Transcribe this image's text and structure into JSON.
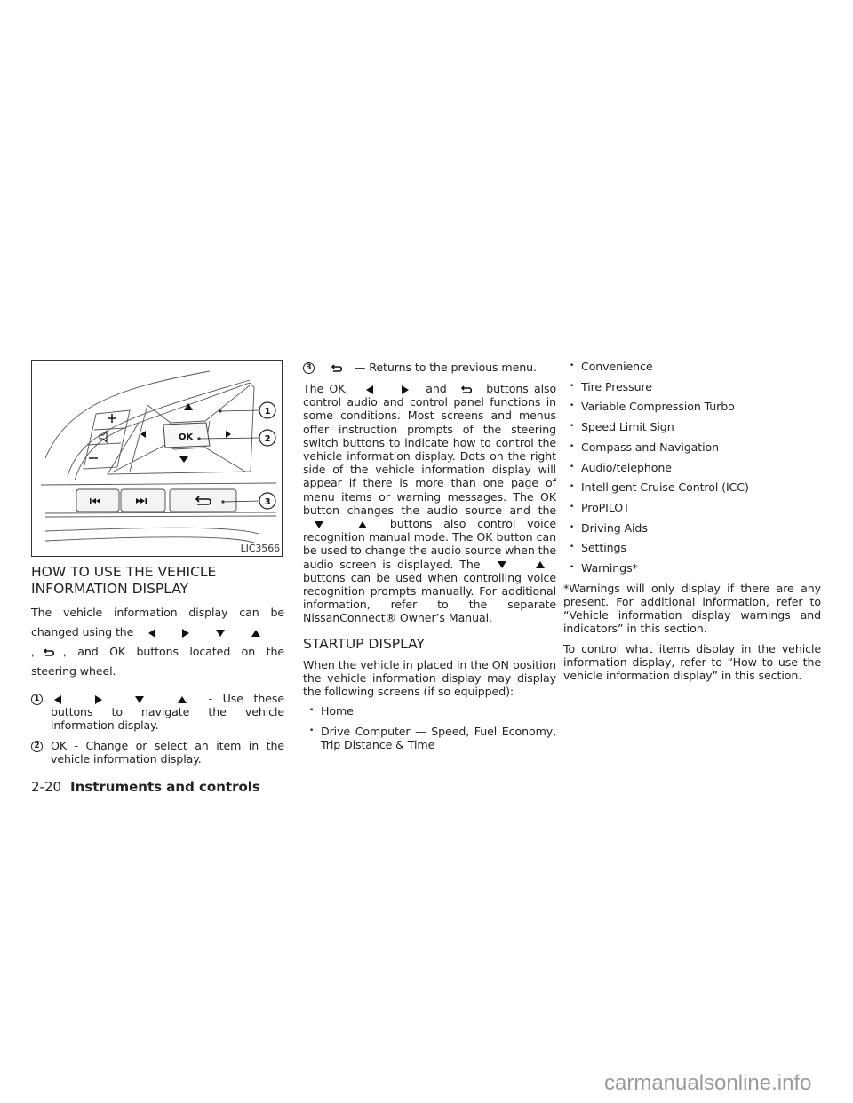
{
  "figure": {
    "label": "LIC3566",
    "callouts": [
      "1",
      "2",
      "3"
    ],
    "ok_button_label": "OK",
    "icons": [
      "volume-up-icon",
      "mute-icon",
      "volume-down-icon",
      "left-arrow-icon",
      "up-arrow-icon",
      "right-arrow-icon",
      "down-arrow-icon",
      "previous-track-icon",
      "next-track-icon",
      "back-icon"
    ]
  },
  "section1": {
    "heading_line1": "HOW TO USE THE VEHICLE",
    "heading_line2": "INFORMATION DISPLAY",
    "intro_part1": "The vehicle information display can be changed using the",
    "intro_part2": ",",
    "intro_part3": ", and OK buttons located on the steering wheel.",
    "items": [
      {
        "num": "1",
        "text": "- Use these buttons to navigate the vehicle information display."
      },
      {
        "num": "2",
        "text": "OK - Change or select an item in the vehicle information display."
      },
      {
        "num": "3",
        "text": "— Returns to the previous menu."
      }
    ],
    "para_part1": "The OK,",
    "para_part2": "and",
    "para_part3": "buttons also control audio and control panel functions in some conditions. Most screens and menus offer instruction prompts of the steering switch buttons to indicate how to control the vehicle information display. Dots on the right side of the vehicle information display will appear if there is more than one page of menu items or warning messages. The OK button changes the audio source and the",
    "para_part4": "buttons also control voice recognition manual mode. The OK button can be used to change the audio source when the audio screen is displayed. The",
    "para_part5": "buttons can be used when controlling voice recognition prompts manually. For additional information, refer to the separate NissanConnect® Owner’s Manual."
  },
  "section2": {
    "heading": "STARTUP DISPLAY",
    "intro": "When the vehicle in placed in the ON position the vehicle information display may display the following screens (if so equipped):",
    "screens": [
      "Home",
      "Drive Computer — Speed, Fuel Economy, Trip Distance & Time",
      "Convenience",
      "Tire Pressure",
      "Variable Compression Turbo",
      "Speed Limit Sign",
      "Compass and Navigation",
      "Audio/telephone",
      "Intelligent Cruise Control (ICC)",
      "ProPILOT",
      "Driving Aids",
      "Settings",
      "Warnings*"
    ],
    "note": "*Warnings will only display if there are any present. For additional information, refer to “Vehicle information display warnings and indicators” in this section.",
    "closing": "To control what items display in the vehicle information display, refer to “How to use the vehicle information display” in this section."
  },
  "footer": {
    "page_number": "2-20",
    "chapter_title": "Instruments and controls"
  },
  "watermark": "carmanualsonline.info"
}
